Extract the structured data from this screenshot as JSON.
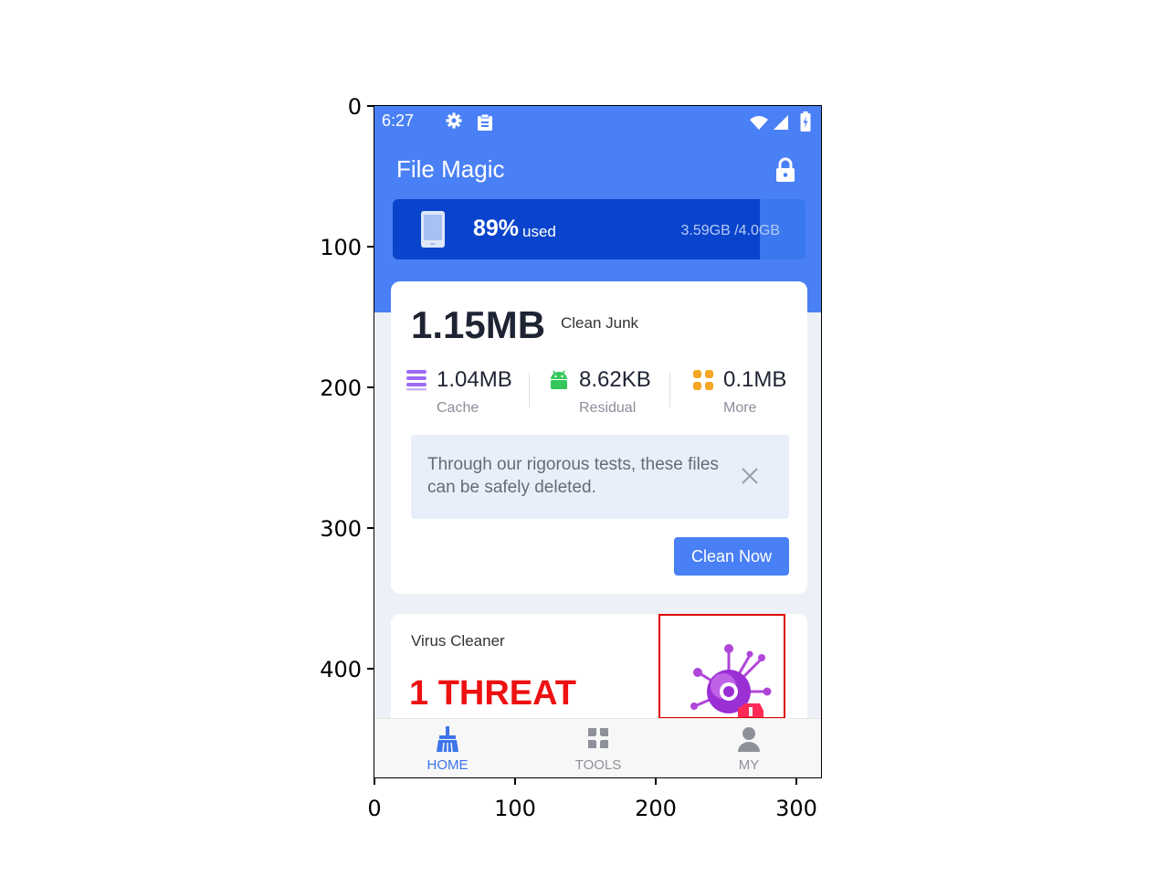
{
  "axes": {
    "x_ticks": [
      "0",
      "100",
      "200",
      "300"
    ],
    "y_ticks": [
      "0",
      "100",
      "200",
      "300",
      "400"
    ]
  },
  "status_bar": {
    "time": "6:27",
    "icons": [
      "gear-icon",
      "clipboard-icon",
      "wifi-icon",
      "signal-icon",
      "battery-icon"
    ]
  },
  "app": {
    "title": "File Magic",
    "lock_icon": "lock-icon"
  },
  "storage": {
    "percent_label": "89%",
    "used_label": "used",
    "size_label": "3.59GB /4.0GB",
    "used_fraction": 0.89
  },
  "junk": {
    "size": "1.15MB",
    "label": "Clean Junk",
    "stats": [
      {
        "value": "1.04MB",
        "label": "Cache",
        "icon": "stack-icon"
      },
      {
        "value": "8.62KB",
        "label": "Residual",
        "icon": "android-icon"
      },
      {
        "value": "0.1MB",
        "label": "More",
        "icon": "apps-icon"
      }
    ],
    "tip": "Through our rigorous tests, these files can be safely deleted.",
    "button": "Clean Now"
  },
  "virus": {
    "title": "Virus Cleaner",
    "threat": "1 THREAT"
  },
  "nav": [
    {
      "label": "HOME",
      "icon": "broom-icon",
      "active": true
    },
    {
      "label": "TOOLS",
      "icon": "tools-icon",
      "active": false
    },
    {
      "label": "MY",
      "icon": "user-icon",
      "active": false
    }
  ],
  "colors": {
    "primary": "#4a80f5",
    "storage_fill": "#0a44cc",
    "threat_red": "#ee1111",
    "highlight_red": "#e00000"
  }
}
